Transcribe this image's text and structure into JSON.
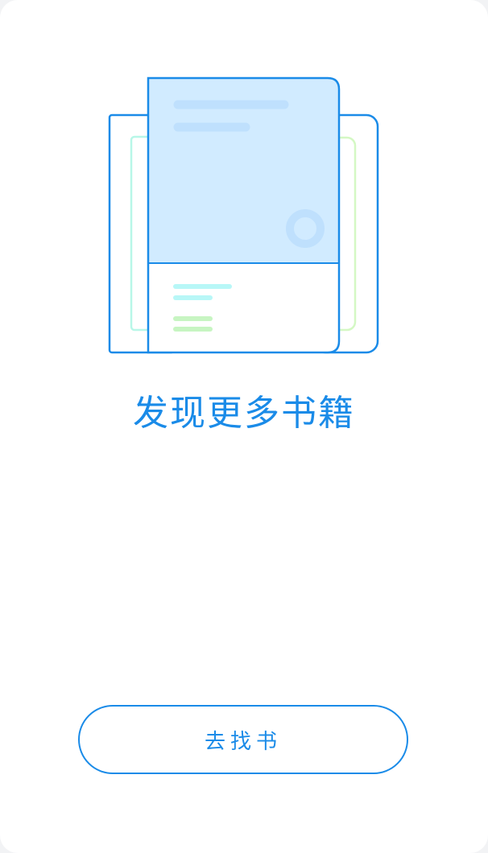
{
  "empty_state": {
    "illustration_icon": "book-stack-icon",
    "title": "发现更多书籍",
    "button_label": "去找书"
  },
  "colors": {
    "accent": "#1a8be8",
    "book_fill": "#d1ebff",
    "circle": "#bfe0fd",
    "line_cyan": "#b8f7f7",
    "line_green": "#c7f5c2",
    "background": "#ffffff"
  }
}
